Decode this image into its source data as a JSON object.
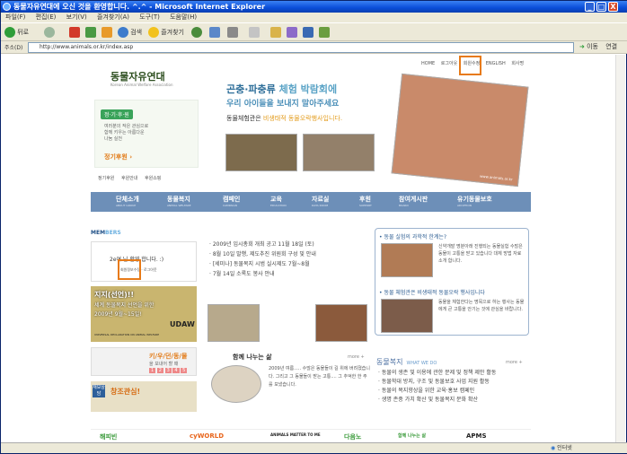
{
  "window": {
    "title": "동물자유연대에 오신 것을 환영합니다. ^.^ - Microsoft Internet Explorer",
    "controls": [
      "_",
      "□",
      "X"
    ]
  },
  "menu": [
    "파일(F)",
    "편집(E)",
    "보기(V)",
    "즐겨찾기(A)",
    "도구(T)",
    "도움말(H)"
  ],
  "toolbar": {
    "back": "뒤로",
    "search": "검색",
    "favorites": "즐겨찾기"
  },
  "address": {
    "label": "주소(D)",
    "url": "http://www.animals.or.kr/index.asp",
    "go": "이동",
    "links": "연결"
  },
  "site": {
    "logo": "동물자유연대",
    "logo_sub": "Korean Animal Welfare Association",
    "top_links": [
      "HOME",
      "로그아웃",
      "회원수정",
      "ENGLISH",
      "회사명"
    ],
    "headline1_a": "곤충·파충류",
    "headline1_b": " 체험 박람회에",
    "headline2": "우리 아이들을 보내지 말아주세요",
    "headline3_a": "동물체험관은 ",
    "headline3_b": "비생태적 동물오락행사입니다.",
    "photo_caption": "www.animals.or.kr",
    "promo": {
      "tag": "정·기·후·원",
      "text": "여러분의 작은 관심으로\n함께 키우는 아름다운\n나눔 실천",
      "link": "정기후원 ›"
    },
    "sub_links": [
      "정기후원",
      "후원안내",
      "후원쇼핑"
    ]
  },
  "nav": {
    "items": [
      {
        "label": "단체소개",
        "sub": "ABOUT GROUP"
      },
      {
        "label": "동물복지",
        "sub": "ANIMAL WELFARE"
      },
      {
        "label": "캠페인",
        "sub": "CAMPAIGN"
      },
      {
        "label": "교육",
        "sub": "EDUCATION"
      },
      {
        "label": "자료실",
        "sub": "DATA ROOM"
      },
      {
        "label": "후원",
        "sub": "SUPPORT"
      },
      {
        "label": "참여게시판",
        "sub": "BOARD"
      },
      {
        "label": "유기동물보호",
        "sub": "ADOPTION"
      }
    ]
  },
  "members": {
    "title_a": "MEM",
    "title_b": "BERS",
    "greeting": "2e여 님 환영 합니다. :)",
    "links": "회원정보수정 · 로그아웃"
  },
  "news": [
    "· 2009년 임시총회 개최 공고 11월 18일 (토)",
    "· 8월 10일 발행, 제도추진 위원회 구성 및 안내",
    "· [세미나] 동물복지 시범 실시제도 7월~8월",
    "· 7월 14일 소록도 봉사 안내"
  ],
  "right_box": {
    "item1_title": "• 동물 실험의 과학적 한계는?",
    "item1_text": "신약개발 명분아래 진행되는 동물실험 수많은 동물이 고통을 받고 있습니다 대체 방법 자료 소개 합니다.",
    "item2_title": "• 동물 체험관은 비생태적 동물오락 행사입니다",
    "item2_text": "동물을 체험한다는 명목으로 하는 행사는 동물에게 큰 고통을 안기는 것에 관심을 바랍니다."
  },
  "story": {
    "title": "함께 나누는 삶",
    "more": "more +",
    "text": "2009년 여름..... 수많은 동물들이 길 위에 버려졌습니다. 그리고 그 동물들이 받는 고통.... 그 추억한 한 주를 보냈습니다."
  },
  "welfare": {
    "title": "동물복지",
    "sub": "WHAT WE DO",
    "more": "more +",
    "items": [
      "· 동물의 생존 및 이용에 관한 문제 및 정책 제안 활동",
      "· 동물학대 방지, 구조 및 동물보호 사업 지원 활동",
      "· 동물의 복지향상을 위한 교육·홍보 캠페인",
      "· 생명 존중 가치 확산 및 동물복지 문화 확산"
    ]
  },
  "banners": {
    "udaw_title": "지지(선언)!!",
    "udaw_sub": "세계 동물복지 선언을 위한",
    "udaw_date": "2009년 9월~15일!",
    "udaw_logo": "UDAW",
    "udaw_caption": "UNIVERSAL DECLARATION ON ANIMAL WELFARE",
    "kibo": "키/우/던/동/물",
    "kibo_sub": "을 보내어 할 때",
    "kibo_nums": [
      "1",
      "2",
      "3",
      "4",
      "5"
    ],
    "charity_tag": "재보상담",
    "charity_title": "창조관심!"
  },
  "footer_logos": [
    "해피빈",
    "cyWORLD",
    "ANIMALS MATTER TO ME",
    "다음노",
    "함께 나누는 삶",
    "APMS"
  ],
  "status": {
    "left": "",
    "right": "인터넷"
  }
}
